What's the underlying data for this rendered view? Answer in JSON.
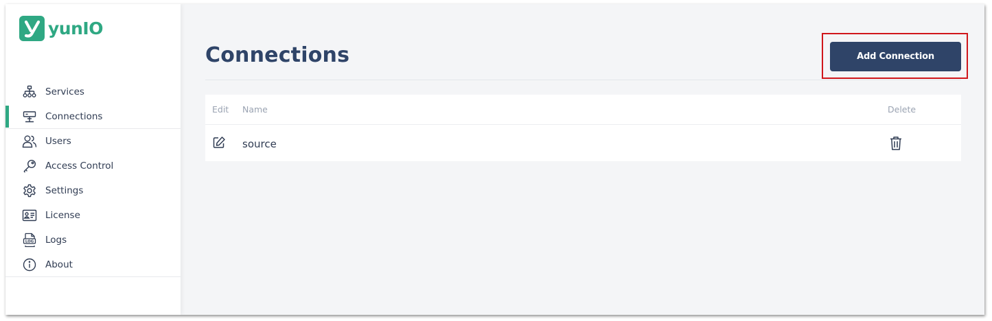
{
  "app": {
    "name": "yunIO",
    "logo_letter": "y",
    "brand_color": "#2fa883",
    "primary_color": "#2f4468"
  },
  "sidebar": {
    "items": [
      {
        "label": "Services",
        "icon": "sitemap-icon",
        "active": false
      },
      {
        "label": "Connections",
        "icon": "server-icon",
        "active": true
      },
      {
        "label": "Users",
        "icon": "users-icon",
        "active": false
      },
      {
        "label": "Access Control",
        "icon": "key-icon",
        "active": false
      },
      {
        "label": "Settings",
        "icon": "gear-icon",
        "active": false
      },
      {
        "label": "License",
        "icon": "id-card-icon",
        "active": false
      },
      {
        "label": "Logs",
        "icon": "log-file-icon",
        "active": false
      },
      {
        "label": "About",
        "icon": "info-icon",
        "active": false
      }
    ]
  },
  "main": {
    "title": "Connections",
    "add_button_label": "Add Connection",
    "table": {
      "columns": {
        "edit": "Edit",
        "name": "Name",
        "delete": "Delete"
      },
      "rows": [
        {
          "name": "source"
        }
      ]
    }
  }
}
